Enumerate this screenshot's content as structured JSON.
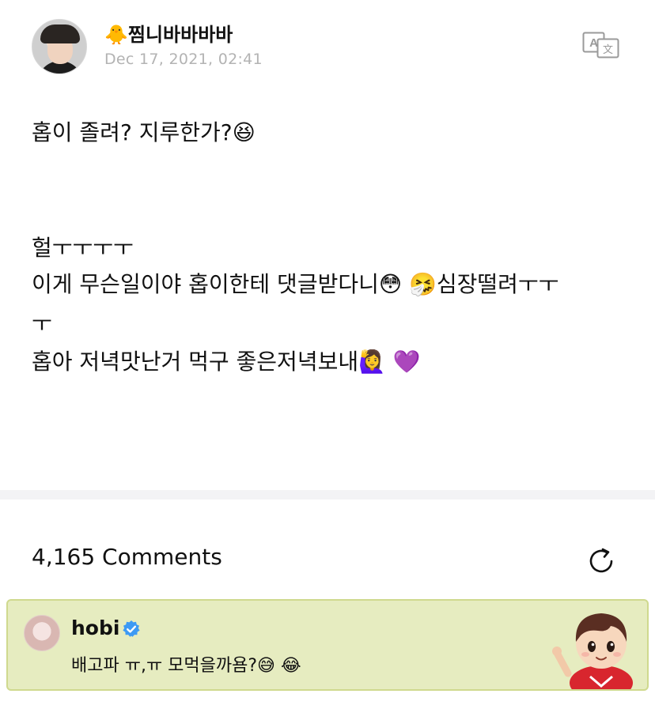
{
  "post": {
    "author": "🐥찜니바바바바",
    "date": "Dec 17, 2021, 02:41",
    "translate_icon": "translate-icon",
    "lines": [
      "홉이 졸려? 지루한가?😆",
      "헐ㅜㅜㅜㅜ",
      " 이게 무슨일이야 홉이한테 댓글받다니😳 🤧심장떨려ㅜㅜ",
      "ㅜ",
      "홉아 저녁맛난거 먹구 좋은저녁보내🙋‍♀️ 💜"
    ]
  },
  "comments": {
    "count_label": "4,165 Comments",
    "refresh_icon": "refresh-icon"
  },
  "comment": {
    "author": "hobi",
    "verified_icon": "verified-badge-icon",
    "text": "배고파 ㅠ,ㅠ 모먹을까욤?😅 😂",
    "accent_bg": "#e6ecc0"
  }
}
